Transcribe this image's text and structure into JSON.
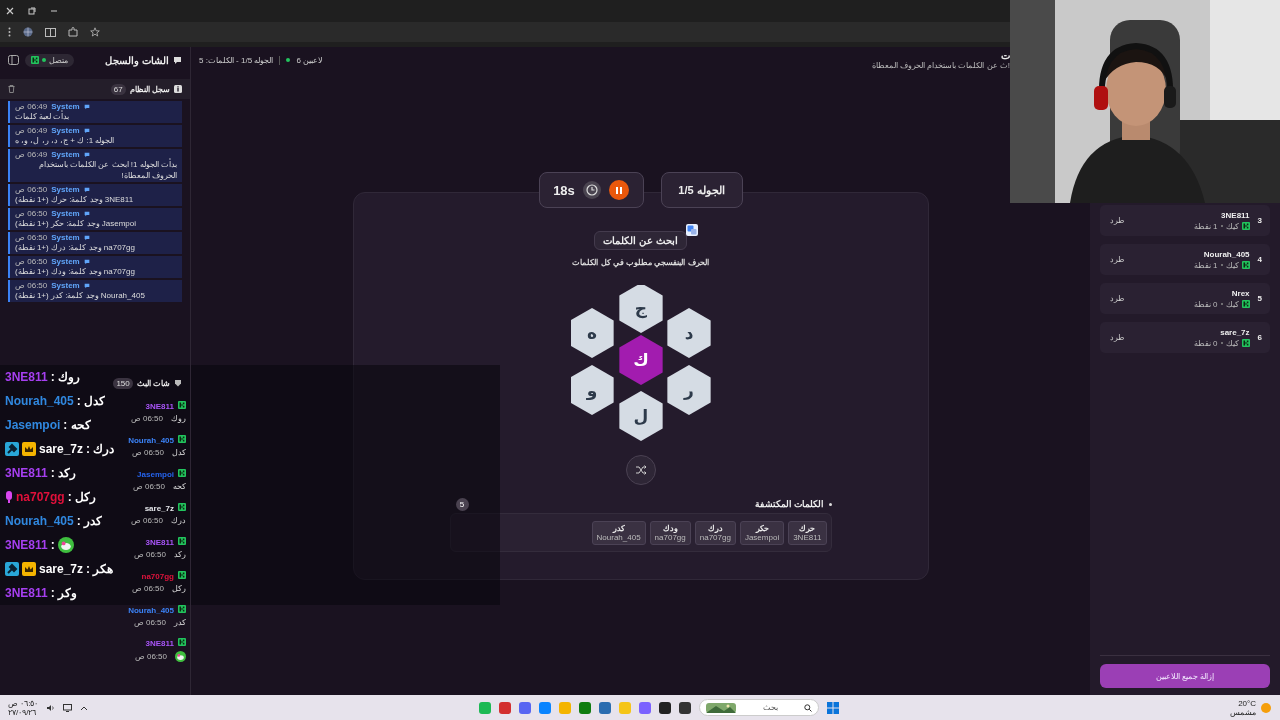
{
  "chat_panel": {
    "title": "الشات والسجل",
    "status": "متصل",
    "log": {
      "title": "سجل النظام",
      "count": "67",
      "entries": [
        {
          "source": "System",
          "time": "06:49 ص",
          "text": "بدأت لعبة كلمات"
        },
        {
          "source": "System",
          "time": "06:49 ص",
          "text": "الجوله 1: ك + ج، د، ر، ل، و، ه"
        },
        {
          "source": "System",
          "time": "06:49 ص",
          "text": "بدأت الجوله 1! ابحث عن الكلمات باستخدام الحروف المعطاة!"
        },
        {
          "source": "System",
          "time": "06:50 ص",
          "text": "3NE811 وجد كلمة: حرك (+1 نقطة)"
        },
        {
          "source": "System",
          "time": "06:50 ص",
          "text": "Jasempoi وجد كلمة: حكر (+1 نقطة)"
        },
        {
          "source": "System",
          "time": "06:50 ص",
          "text": "na707gg وجد كلمة: درك (+1 نقطة)"
        },
        {
          "source": "System",
          "time": "06:50 ص",
          "text": "na707gg وجد كلمة: ودك (+1 نقطة)"
        },
        {
          "source": "System",
          "time": "06:50 ص",
          "text": "Nourah_405 وجد كلمة: كدر (+1 نقطة)"
        }
      ]
    },
    "stream_chat": {
      "title": "شات البث",
      "count": "150",
      "messages": [
        {
          "user": "3NE811",
          "color": "#a855f7",
          "time": "06:50 ص",
          "kind": "text",
          "text": "روك"
        },
        {
          "user": "Nourah_405",
          "color": "#3b82f6",
          "time": "06:50 ص",
          "kind": "text",
          "text": "كدل"
        },
        {
          "user": "Jasempoi",
          "color": "#2563eb",
          "time": "06:50 ص",
          "kind": "text",
          "text": "كحه"
        },
        {
          "user": "sare_7z",
          "color": "#e5e7eb",
          "time": "06:50 ص",
          "kind": "text",
          "text": "درك"
        },
        {
          "user": "3NE811",
          "color": "#a855f7",
          "time": "06:50 ص",
          "kind": "text",
          "text": "ركد"
        },
        {
          "user": "na707gg",
          "color": "#dc143c",
          "time": "06:50 ص",
          "kind": "text",
          "text": "ركل"
        },
        {
          "user": "Nourah_405",
          "color": "#3b82f6",
          "time": "06:50 ص",
          "kind": "text",
          "text": "كدر"
        },
        {
          "user": "3NE811",
          "color": "#a855f7",
          "time": "06:50 ص",
          "kind": "emote"
        }
      ]
    }
  },
  "stream_overlay": {
    "lines": [
      {
        "user": "3NE811",
        "color": "#a63ff0",
        "kind": "text",
        "message": ": روك"
      },
      {
        "user": "Nourah_405",
        "color": "#3088e0",
        "kind": "text",
        "message": ": كدل"
      },
      {
        "user": "Jasempoi",
        "color": "#3088e0",
        "kind": "text",
        "message": ": كحه"
      },
      {
        "user": "sare_7z",
        "color": "#ffffff",
        "kind": "text",
        "message": ": درك",
        "badges": [
          {
            "kind": "wrench"
          },
          {
            "kind": "crown"
          }
        ]
      },
      {
        "user": "3NE811",
        "color": "#a63ff0",
        "kind": "text",
        "message": ": ركد"
      },
      {
        "user": "na707gg",
        "color": "#e0103a",
        "kind": "text",
        "message": ": ركل",
        "badges": [
          {
            "kind": "mic"
          }
        ]
      },
      {
        "user": "Nourah_405",
        "color": "#3088e0",
        "kind": "text",
        "message": ": كدر"
      },
      {
        "user": "3NE811",
        "color": "#a63ff0",
        "kind": "emote",
        "message": ":"
      },
      {
        "user": "sare_7z",
        "color": "#ffffff",
        "kind": "text",
        "message": ": هكر",
        "badges": [
          {
            "kind": "wrench"
          },
          {
            "kind": "crown"
          }
        ]
      },
      {
        "user": "3NE811",
        "color": "#a63ff0",
        "kind": "text",
        "message": ": وكر"
      }
    ]
  },
  "top_bar": {
    "round_info": "الجوله 1/5 - الكلمات: 5",
    "players": "6 لاعبين",
    "title": "ت",
    "subtitle": "ث عن الكلمات باستخدام الحروف المعطاة!"
  },
  "game": {
    "timer": "18s",
    "round": "الجوله 1/5",
    "title": "ابحث عن الكلمات",
    "hint": "الحرف البنفسجي مطلوب في كل الكلمات",
    "letters": [
      {
        "letter": "ج",
        "kind": "outer"
      },
      {
        "letter": "د",
        "kind": "outer"
      },
      {
        "letter": "ه",
        "kind": "outer"
      },
      {
        "letter": "ك",
        "kind": "center"
      },
      {
        "letter": "ر",
        "kind": "outer"
      },
      {
        "letter": "و",
        "kind": "outer"
      },
      {
        "letter": "ل",
        "kind": "outer"
      }
    ],
    "found": {
      "title": "الكلمات المكتشفة",
      "count": "5",
      "words": [
        {
          "word": "حرك",
          "player": "3NE811"
        },
        {
          "word": "حكر",
          "player": "Jasempoi"
        },
        {
          "word": "درك",
          "player": "na707gg"
        },
        {
          "word": "ودك",
          "player": "na707gg"
        },
        {
          "word": "كدر",
          "player": "Nourah_405"
        }
      ]
    }
  },
  "players": {
    "items": [
      {
        "rank": "3",
        "name": "3NE811",
        "platform": "كيك",
        "points": "1 نقطة",
        "action": "طرد"
      },
      {
        "rank": "4",
        "name": "Nourah_405",
        "platform": "كيك",
        "points": "1 نقطة",
        "action": "طرد"
      },
      {
        "rank": "5",
        "name": "Nrex",
        "platform": "كيك",
        "points": "0 نقطة",
        "action": "طرد"
      },
      {
        "rank": "6",
        "name": "sare_7z",
        "platform": "كيك",
        "points": "0 نقطة",
        "action": "طرد"
      }
    ],
    "remove_all": "إزالة جميع اللاعبين"
  },
  "taskbar": {
    "time": "٠٦:٥٠ ص",
    "date": "٢٧/٠٩/٢٦",
    "search_placeholder": "بحث",
    "temperature": "20°C",
    "weather": "مشمس"
  }
}
